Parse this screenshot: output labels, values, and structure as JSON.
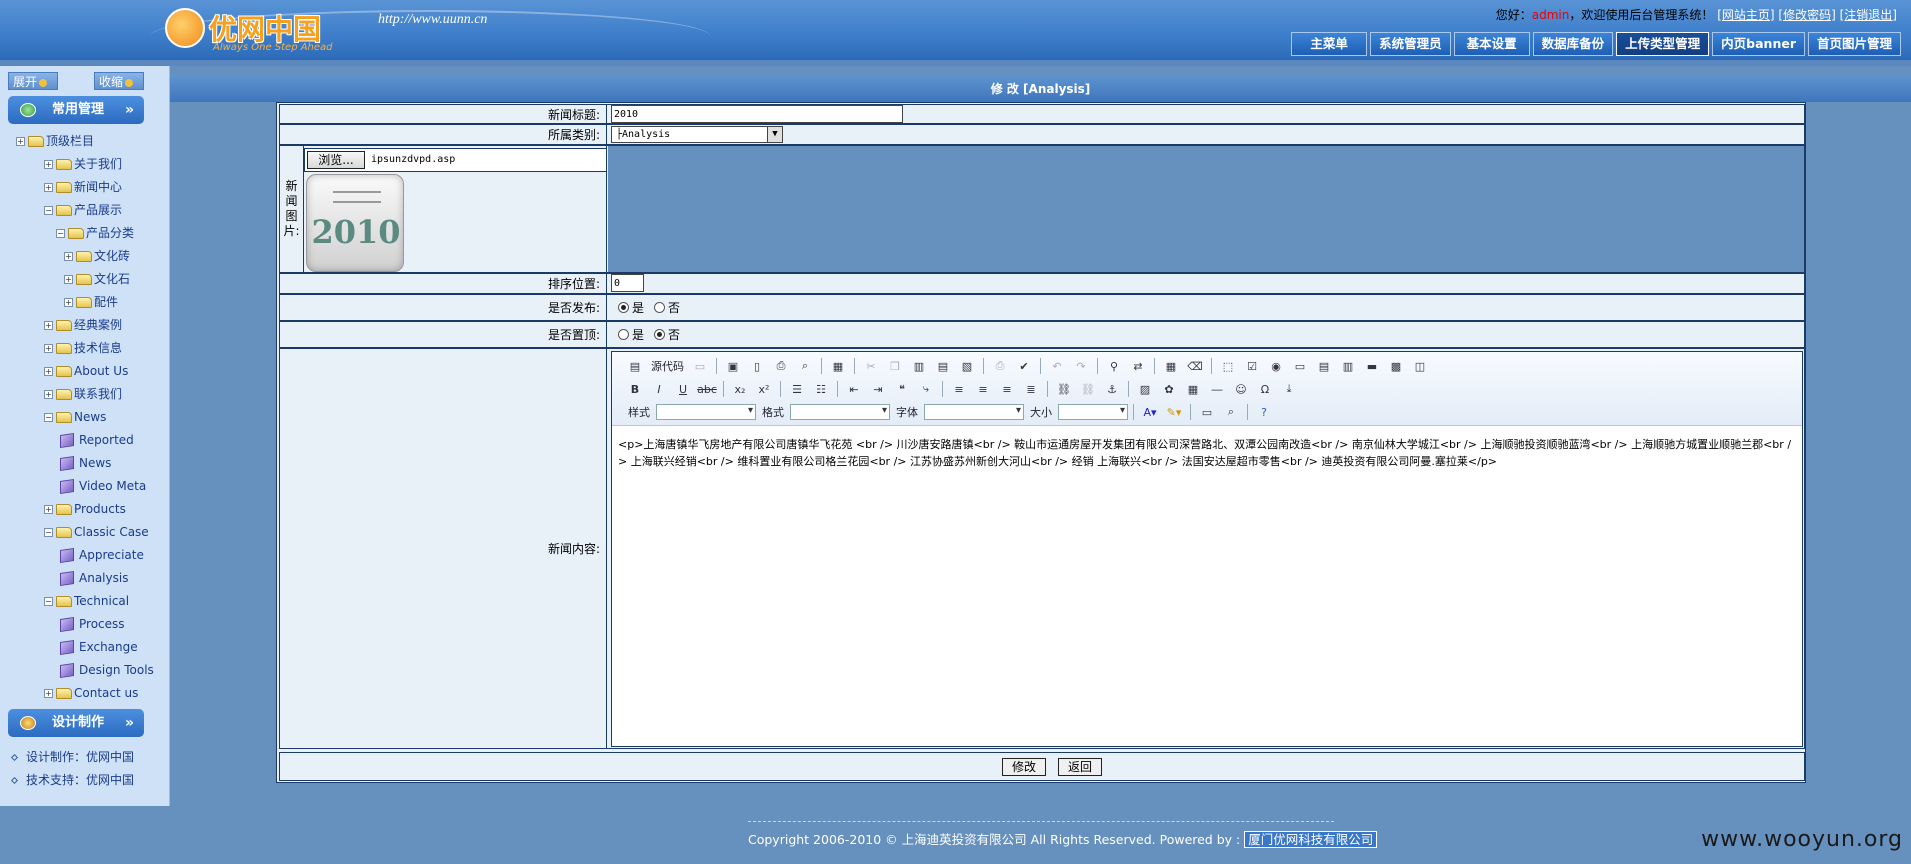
{
  "header": {
    "logo_text": "优网中国",
    "logo_slogan": "Always One Step Ahead",
    "site_url": "http://www.uunn.cn",
    "greeting": "您好：",
    "user": "admin",
    "welcome": "，欢迎使用后台管理系统！",
    "links": [
      "[网站主页]",
      "[修改密码]",
      "[注销退出]"
    ],
    "nav": [
      "主菜单",
      "系统管理员",
      "基本设置",
      "数据库备份",
      "上传类型管理",
      "内页banner",
      "首页图片管理"
    ],
    "active_nav": "上传类型管理"
  },
  "sidebar": {
    "expand": "展开",
    "collapse": "收缩",
    "section1": "常用管理",
    "section2": "设计制作",
    "tree": [
      {
        "label": "顶级栏目",
        "kind": "folder",
        "toggle": "+"
      },
      {
        "label": "关于我们",
        "kind": "folder",
        "toggle": "+"
      },
      {
        "label": "新闻中心",
        "kind": "folder",
        "toggle": "+"
      },
      {
        "label": "产品展示",
        "kind": "folder",
        "toggle": "−"
      },
      {
        "label": "产品分类",
        "kind": "folder",
        "toggle": "−"
      },
      {
        "label": "文化砖",
        "kind": "folder",
        "toggle": "+"
      },
      {
        "label": "文化石",
        "kind": "folder",
        "toggle": "+"
      },
      {
        "label": "配件",
        "kind": "folder",
        "toggle": "+"
      },
      {
        "label": "经典案例",
        "kind": "folder",
        "toggle": "+"
      },
      {
        "label": "技术信息",
        "kind": "folder",
        "toggle": "+"
      },
      {
        "label": "About Us",
        "kind": "folder",
        "toggle": "+"
      },
      {
        "label": "联系我们",
        "kind": "folder",
        "toggle": "+"
      },
      {
        "label": "News",
        "kind": "folder",
        "toggle": "−"
      },
      {
        "label": "Reported",
        "kind": "doc",
        "toggle": ""
      },
      {
        "label": "News",
        "kind": "doc",
        "toggle": ""
      },
      {
        "label": "Video Meta",
        "kind": "doc",
        "toggle": ""
      },
      {
        "label": "Products",
        "kind": "folder",
        "toggle": "+"
      },
      {
        "label": "Classic Case",
        "kind": "folder",
        "toggle": "−"
      },
      {
        "label": "Appreciate",
        "kind": "doc",
        "toggle": ""
      },
      {
        "label": "Analysis",
        "kind": "doc",
        "toggle": ""
      },
      {
        "label": "Technical",
        "kind": "folder",
        "toggle": "−"
      },
      {
        "label": "Process",
        "kind": "doc",
        "toggle": ""
      },
      {
        "label": "Exchange",
        "kind": "doc",
        "toggle": ""
      },
      {
        "label": "Design Tools",
        "kind": "doc",
        "toggle": ""
      },
      {
        "label": "Contact us",
        "kind": "folder",
        "toggle": "+"
      }
    ],
    "credits": [
      "设计制作：优网中国",
      "技术支持：优网中国"
    ]
  },
  "main": {
    "title": "修 改 [Analysis]",
    "labels": {
      "title": "新闻标题:",
      "category": "所属类别:",
      "image": "新闻图片:",
      "order": "排序位置:",
      "publish": "是否发布:",
      "top": "是否置顶:",
      "content": "新闻内容:"
    },
    "title_value": "2010",
    "category_value": "├Analysis",
    "browse_button": "浏览...",
    "file_name": "ipsunzdvpd.asp",
    "thumb_text": "2010",
    "order_value": "0",
    "yes": "是",
    "no": "否",
    "publish_selected": "yes",
    "top_selected": "no",
    "editor": {
      "source": "源代码",
      "style_label": "样式",
      "format_label": "格式",
      "font_label": "字体",
      "size_label": "大小",
      "content": "<p>上海唐镇华飞房地产有限公司唐镇华飞花苑 <br /> 川沙唐安路唐镇<br /> 鞍山市运通房屋开发集团有限公司深营路北、双潭公园南改造<br /> 南京仙林大学城江<br /> 上海顺驰投资顺驰蓝湾<br /> 上海顺驰方城置业顺驰兰郡<br /> 上海联兴经销<br /> 维科置业有限公司格兰花园<br /> 江苏协盛苏州新创大河山<br /> 经销 上海联兴<br /> 法国安达屋超市零售<br /> 迪英投资有限公司阿曼.塞拉莱</p>"
    },
    "submit": "修改",
    "back": "返回"
  },
  "footer": {
    "text": "Copyright 2006-2010 © 上海迪英投资有限公司 All Rights Reserved. Powered by :",
    "company": "厦门优网科技有限公司"
  },
  "watermark": "www.wooyun.org"
}
